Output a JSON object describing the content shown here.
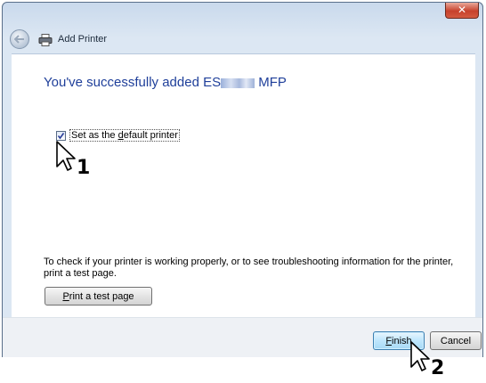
{
  "window": {
    "title": "Add Printer",
    "close_glyph": "✕"
  },
  "content": {
    "headline_prefix": "You've successfully added ES",
    "headline_suffix": " MFP",
    "checkbox": {
      "label_before": "Set as the ",
      "label_underlined": "d",
      "label_after": "efault printer",
      "checked": true
    },
    "info_text": "To check if your printer is working properly, or to see troubleshooting information for the printer, print a test page.",
    "test_button": {
      "underlined": "P",
      "rest": "rint a test page"
    }
  },
  "footer": {
    "finish": {
      "underlined": "F",
      "rest": "inish"
    },
    "cancel_label": "Cancel"
  },
  "annotations": {
    "step1": "1",
    "step2": "2"
  },
  "colors": {
    "headline": "#1f3f9a",
    "close_button": "#c7412c",
    "frame": "#dce7f3"
  }
}
